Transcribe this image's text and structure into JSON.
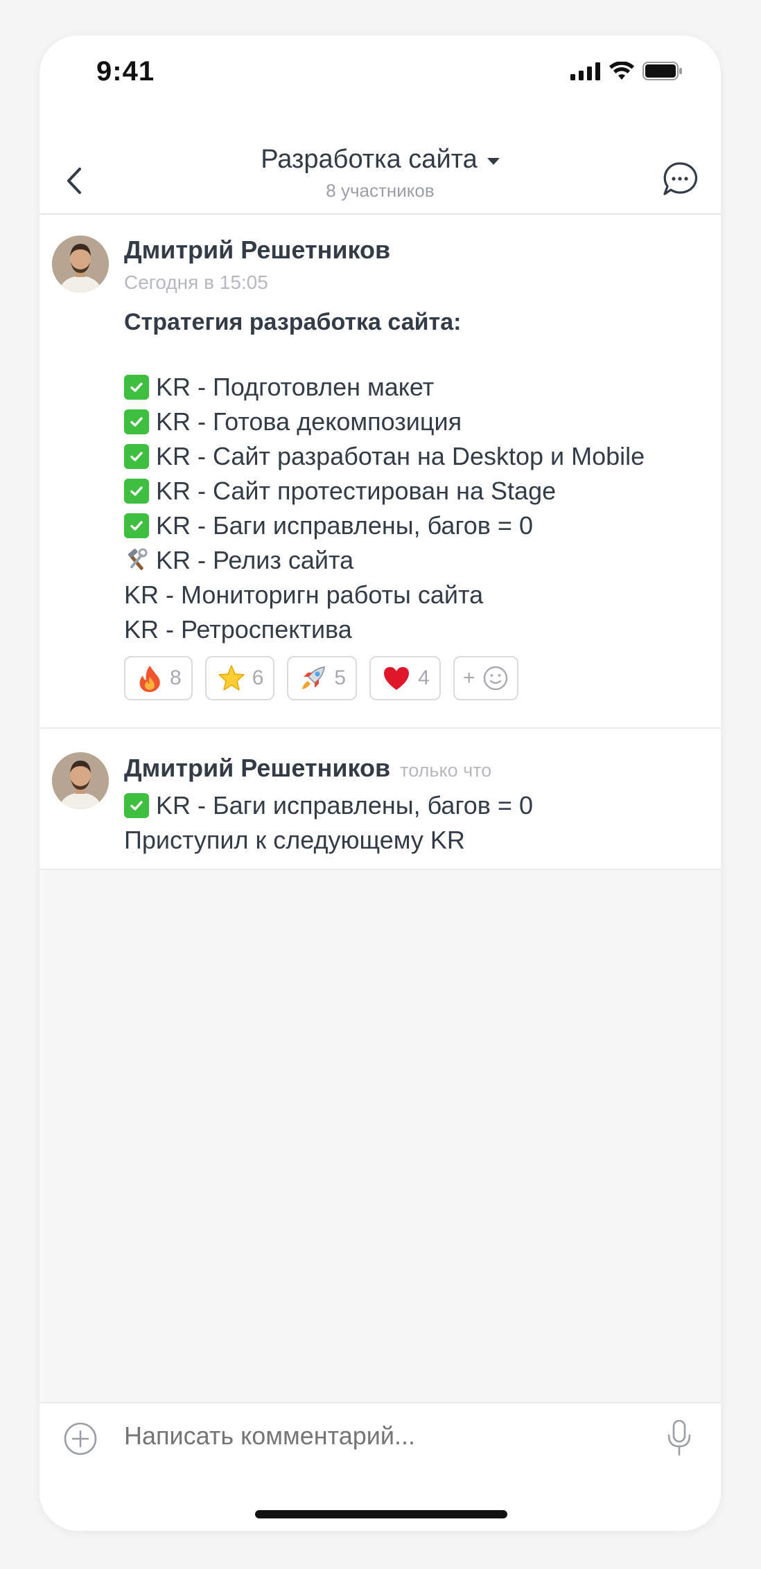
{
  "status_bar": {
    "time": "9:41"
  },
  "header": {
    "title": "Разработка сайта",
    "subtitle": "8 участников"
  },
  "messages": [
    {
      "author": "Дмитрий Решетников",
      "time": "Сегодня в 15:05",
      "heading": "Стратегия разработка сайта:",
      "lines": [
        {
          "icon": "check-icon",
          "text": "KR - Подготовлен макет"
        },
        {
          "icon": "check-icon",
          "text": "KR - Готова декомпозиция"
        },
        {
          "icon": "check-icon",
          "text": "KR - Сайт разработан на Desktop и Mobile"
        },
        {
          "icon": "check-icon",
          "text": "KR - Сайт протестирован на Stage"
        },
        {
          "icon": "check-icon",
          "text": "KR - Баги исправлены, багов = 0"
        },
        {
          "icon": "tools-icon",
          "text": "KR - Релиз сайта"
        },
        {
          "icon": "",
          "text": "KR - Мониторигн работы сайта"
        },
        {
          "icon": "",
          "text": "KR - Ретроспектива"
        }
      ],
      "reactions": [
        {
          "emoji": "fire-icon",
          "count": "8"
        },
        {
          "emoji": "star-icon",
          "count": "6"
        },
        {
          "emoji": "rocket-icon",
          "count": "5"
        },
        {
          "emoji": "heart-icon",
          "count": "4"
        }
      ],
      "add_reaction_label": "+"
    },
    {
      "author": "Дмитрий Решетников",
      "time": "только что",
      "lines": [
        {
          "icon": "check-icon",
          "text": "KR - Баги исправлены, багов = 0"
        },
        {
          "icon": "",
          "text": "Приступил к следующему KR"
        }
      ]
    }
  ],
  "composer": {
    "placeholder": "Написать комментарий..."
  },
  "colors": {
    "accent_check": "#3fbf3f",
    "text": "#333b46",
    "muted": "#b5b8bd"
  }
}
